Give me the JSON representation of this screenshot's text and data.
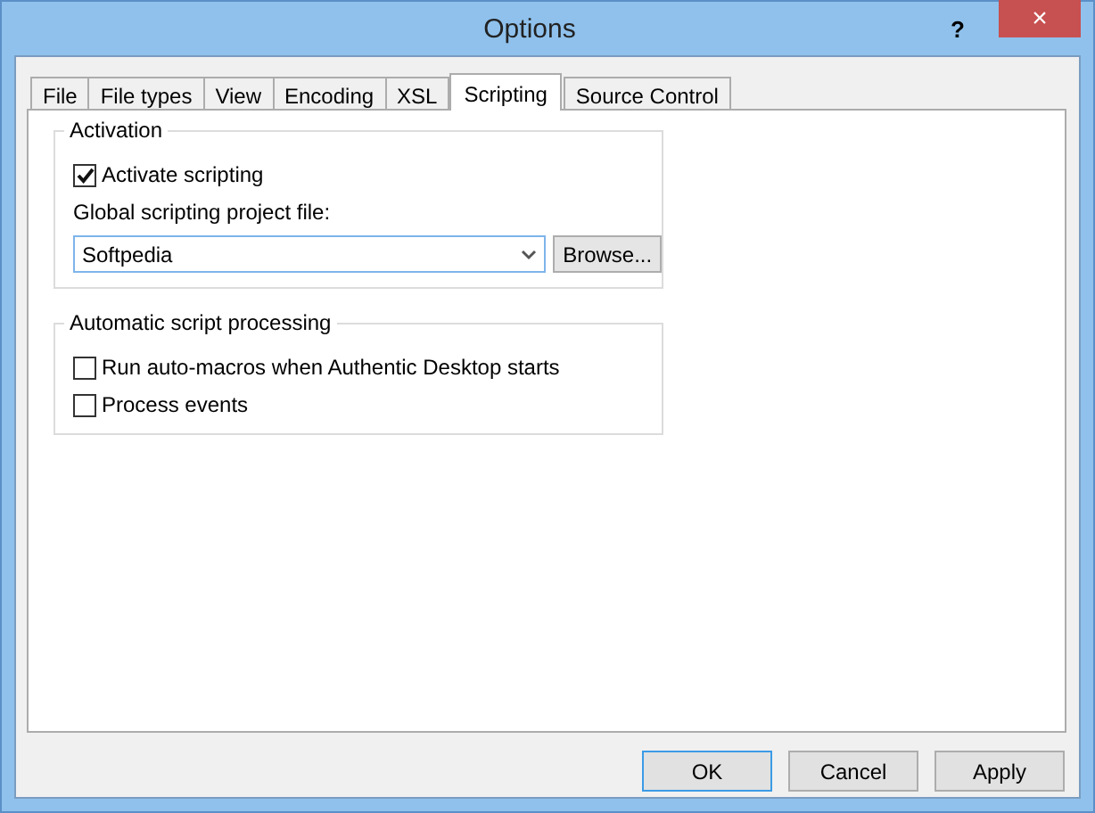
{
  "window": {
    "title": "Options",
    "help": "?",
    "close": "×"
  },
  "tabs": [
    {
      "label": "File",
      "selected": false
    },
    {
      "label": "File types",
      "selected": false
    },
    {
      "label": "View",
      "selected": false
    },
    {
      "label": "Encoding",
      "selected": false
    },
    {
      "label": "XSL",
      "selected": false
    },
    {
      "label": "Scripting",
      "selected": true
    },
    {
      "label": "Source Control",
      "selected": false
    }
  ],
  "groups": [
    {
      "title": "Activation",
      "items": [
        {
          "kind": "checkbox",
          "label": "Activate scripting",
          "checked": true
        },
        {
          "kind": "label",
          "label": "Global scripting project file:"
        },
        {
          "kind": "combo",
          "value": "Softpedia",
          "button": "Browse..."
        }
      ]
    },
    {
      "title": "Automatic script processing",
      "items": [
        {
          "kind": "checkbox",
          "label": "Run auto-macros when Authentic Desktop starts",
          "checked": false
        },
        {
          "kind": "checkbox",
          "label": "Process events",
          "checked": false
        }
      ]
    }
  ],
  "buttons": [
    {
      "label": "OK",
      "default": true
    },
    {
      "label": "Cancel",
      "default": false
    },
    {
      "label": "Apply",
      "default": false
    }
  ]
}
